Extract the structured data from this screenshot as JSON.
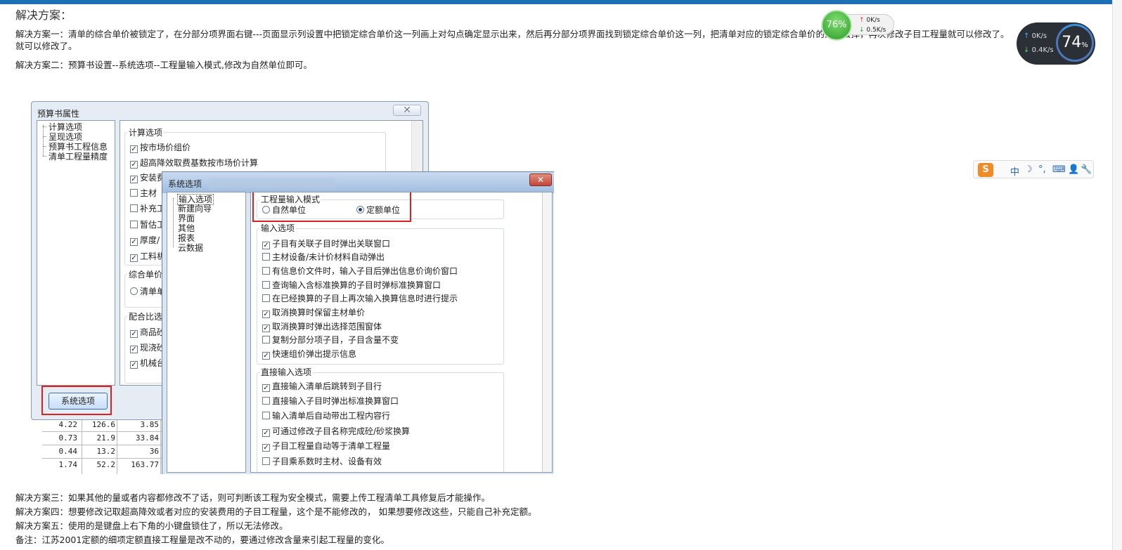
{
  "article": {
    "heading": "解决方案：",
    "solution1_line1": "解决方案一：清单的综合单价被锁定了，在分部分项界面右键---页面显示列设置中把锁定综合单价这一列画上对勾点确定显示出来，然后再分部分项界面找到锁定综合单价这一列，把清单对应的锁定综合单价的对勾去掉，再次修改子目工程量就可以修改了。",
    "solution1_line2": "就可以修改了。",
    "solution2": "解决方案二：预算书设置--系统选项--工程量输入模式,修改为自然单位即可。",
    "solution3": "解决方案三：如果其他的量或者内容都修改不了话，则可判断该工程为安全模式，需要上传工程清单工具修复后才能操作。",
    "solution4": "解决方案四：想要修改记取超高降效或者对应的安装费用的子目工程量，这个是不能修改的， 如果想要修改这些，只能自己补充定额。",
    "solution5": "解决方案五：使用的是键盘上右下角的小键盘锁住了，所以无法修改。",
    "note": "备注：江苏2001定额的细项定额直接工程量是改不动的，要通过修改含量来引起工程量的变化。"
  },
  "budget_window": {
    "title": "预算书属性",
    "close_label": "⨉",
    "tree": [
      "计算选项",
      "呈现选项",
      "预算书工程信息",
      "清单工程量精度"
    ],
    "calc_group_label": "计算选项",
    "calc_items": [
      {
        "label": "按市场价组价",
        "checked": true
      },
      {
        "label": "超高降效取费基数按市场价计算",
        "checked": true
      },
      {
        "label": "安装费",
        "checked": true
      },
      {
        "label": "主材",
        "checked": false
      },
      {
        "label": "补充工",
        "checked": false
      },
      {
        "label": "暂估工",
        "checked": false
      },
      {
        "label": "厚度/",
        "checked": true
      },
      {
        "label": "工料机",
        "checked": true
      }
    ],
    "unit_group_label": "综合单价",
    "unit_radio": "清单单",
    "mix_group_label": "配合比选",
    "mix_items": [
      {
        "label": "商品砼",
        "checked": true
      },
      {
        "label": "现浇砼",
        "checked": true
      },
      {
        "label": "机械台",
        "checked": true
      }
    ],
    "system_button": "系统选项"
  },
  "table_fragment": {
    "rows": [
      [
        "4.22",
        "126.6",
        "3.85"
      ],
      [
        "0.73",
        "21.9",
        "33.84"
      ],
      [
        "0.44",
        "13.2",
        "36"
      ],
      [
        "1.74",
        "52.2",
        "163.77"
      ]
    ]
  },
  "system_window": {
    "title": "系统选项",
    "close_label": "✕",
    "tree": [
      "输入选项",
      "新建向导",
      "界面",
      "其他",
      "报表",
      "云数据"
    ],
    "mode_group_label": "工程量输入模式",
    "mode_options": [
      {
        "label": "自然单位",
        "selected": false
      },
      {
        "label": "定额单位",
        "selected": true
      }
    ],
    "input_group_label": "输入选项",
    "input_items": [
      {
        "label": "子目有关联子目时弹出关联窗口",
        "checked": true
      },
      {
        "label": "主材设备/未计价材料自动弹出",
        "checked": false
      },
      {
        "label": "有信息价文件时，输入子目后弹出信息价询价窗口",
        "checked": false
      },
      {
        "label": "查询输入含标准换算的子目时弹标准换算窗口",
        "checked": false
      },
      {
        "label": "在已经换算的子目上再次输入换算信息时进行提示",
        "checked": false
      },
      {
        "label": "取消换算时保留主材单价",
        "checked": true
      },
      {
        "label": "取消换算时弹出选择范围窗体",
        "checked": true
      },
      {
        "label": "复制分部分项子目，子目含量不变",
        "checked": false
      },
      {
        "label": "快速组价弹出提示信息",
        "checked": true
      }
    ],
    "direct_group_label": "直接输入选项",
    "direct_items": [
      {
        "label": "直接输入清单后跳转到子目行",
        "checked": true
      },
      {
        "label": "直接输入子目时弹出标准换算窗口",
        "checked": false
      },
      {
        "label": "输入清单后自动带出工程内容行",
        "checked": false
      },
      {
        "label": "可通过修改子目名称完成砼/砂浆换算",
        "checked": true
      },
      {
        "label": "子目工程量自动等于清单工程量",
        "checked": true
      },
      {
        "label": "子目乘系数时主材、设备有效",
        "checked": false
      }
    ]
  },
  "net_meter": {
    "percent": "76%",
    "up": "0K/s",
    "down": "0.5K/s"
  },
  "sys_monitor": {
    "up": "0K/s",
    "down": "0.4K/s",
    "percent": "74",
    "unit": "%"
  },
  "ime_toolbar": {
    "logo": "S",
    "items": [
      "中",
      "☽",
      "°,",
      "⌨",
      "👤",
      "🔧"
    ]
  }
}
